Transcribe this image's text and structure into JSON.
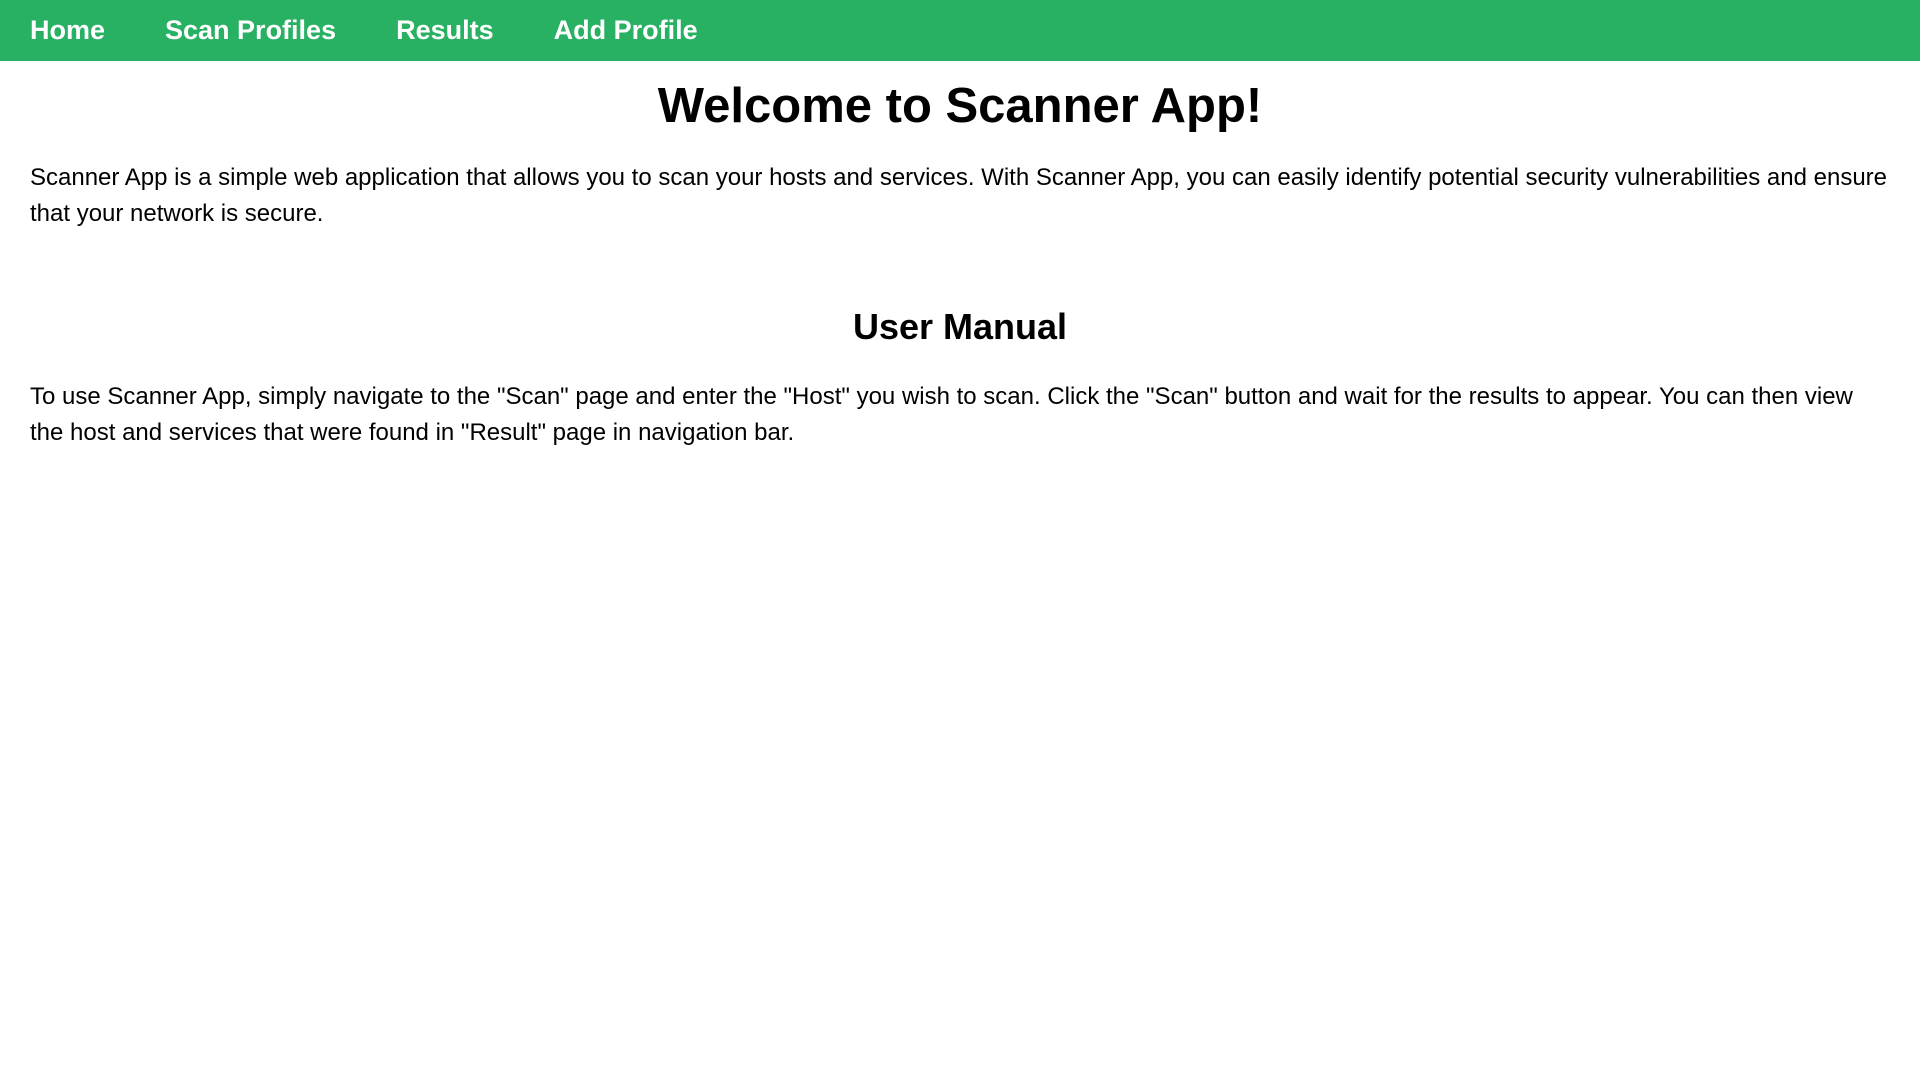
{
  "nav": {
    "items": [
      {
        "label": "Home"
      },
      {
        "label": "Scan Profiles"
      },
      {
        "label": "Results"
      },
      {
        "label": "Add Profile"
      }
    ],
    "background": "#28b063"
  },
  "main": {
    "title": "Welcome to Scanner App!",
    "intro": "Scanner App is a simple web application that allows you to scan your hosts and services. With Scanner App, you can easily identify potential security vulnerabilities and ensure that your network is secure.",
    "manual_heading": "User Manual",
    "manual_body": "To use Scanner App, simply navigate to the \"Scan\" page and enter the \"Host\" you wish to scan. Click the \"Scan\" button and wait for the results to appear. You can then view the host and services that were found in \"Result\" page in navigation bar."
  }
}
